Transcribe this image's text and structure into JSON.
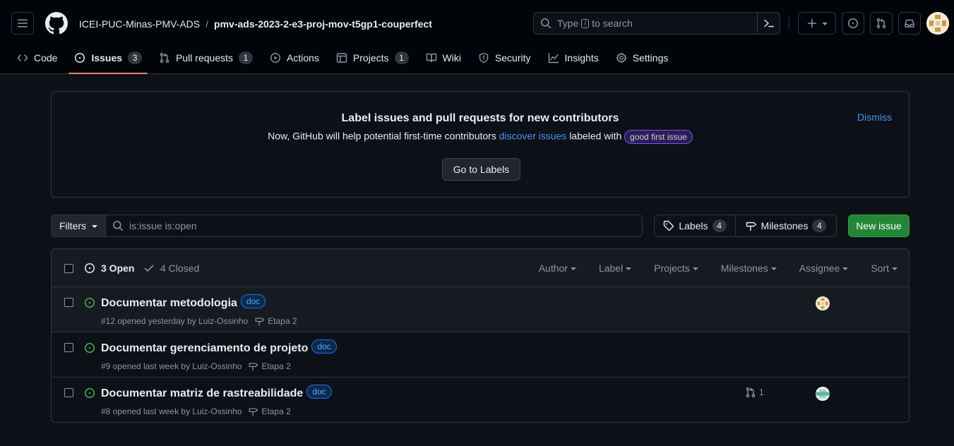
{
  "header": {
    "owner": "ICEI-PUC-Minas-PMV-ADS",
    "separator": "/",
    "repo": "pmv-ads-2023-2-e3-proj-mov-t5gp1-couperfect",
    "search_prefix": "Type",
    "search_key": "/",
    "search_suffix": "to search"
  },
  "nav": {
    "code": "Code",
    "issues": "Issues",
    "issues_count": "3",
    "pulls": "Pull requests",
    "pulls_count": "1",
    "actions": "Actions",
    "projects": "Projects",
    "projects_count": "1",
    "wiki": "Wiki",
    "security": "Security",
    "insights": "Insights",
    "settings": "Settings"
  },
  "banner": {
    "title": "Label issues and pull requests for new contributors",
    "text_before": "Now, GitHub will help potential first-time contributors",
    "link": "discover issues",
    "text_after": "labeled with",
    "label": "good first issue",
    "button": "Go to Labels",
    "dismiss": "Dismiss"
  },
  "filterbar": {
    "filters": "Filters",
    "query": "is:issue is:open",
    "labels": "Labels",
    "labels_count": "4",
    "milestones": "Milestones",
    "milestones_count": "4",
    "new_issue": "New issue"
  },
  "list": {
    "open_label": "3 Open",
    "closed_label": "4 Closed",
    "filters": [
      "Author",
      "Label",
      "Projects",
      "Milestones",
      "Assignee",
      "Sort"
    ],
    "issues": [
      {
        "title": "Documentar metodologia",
        "label": "doc",
        "meta": "#12 opened yesterday by Luiz-Ossinho",
        "milestone": "Etapa 2",
        "pr_count": ""
      },
      {
        "title": "Documentar gerenciamento de projeto",
        "label": "doc",
        "meta": "#9 opened last week by Luiz-Ossinho",
        "milestone": "Etapa 2",
        "pr_count": ""
      },
      {
        "title": "Documentar matriz de rastreabilidade",
        "label": "doc",
        "meta": "#8 opened last week by Luiz-Ossinho",
        "milestone": "Etapa 2",
        "pr_count": "1"
      }
    ]
  },
  "colors": {
    "background": "#0d1117",
    "header_bg": "#010409",
    "accent_tab": "#f78166",
    "link": "#4493f8",
    "open_green": "#3fb950",
    "new_issue_green": "#238636"
  }
}
